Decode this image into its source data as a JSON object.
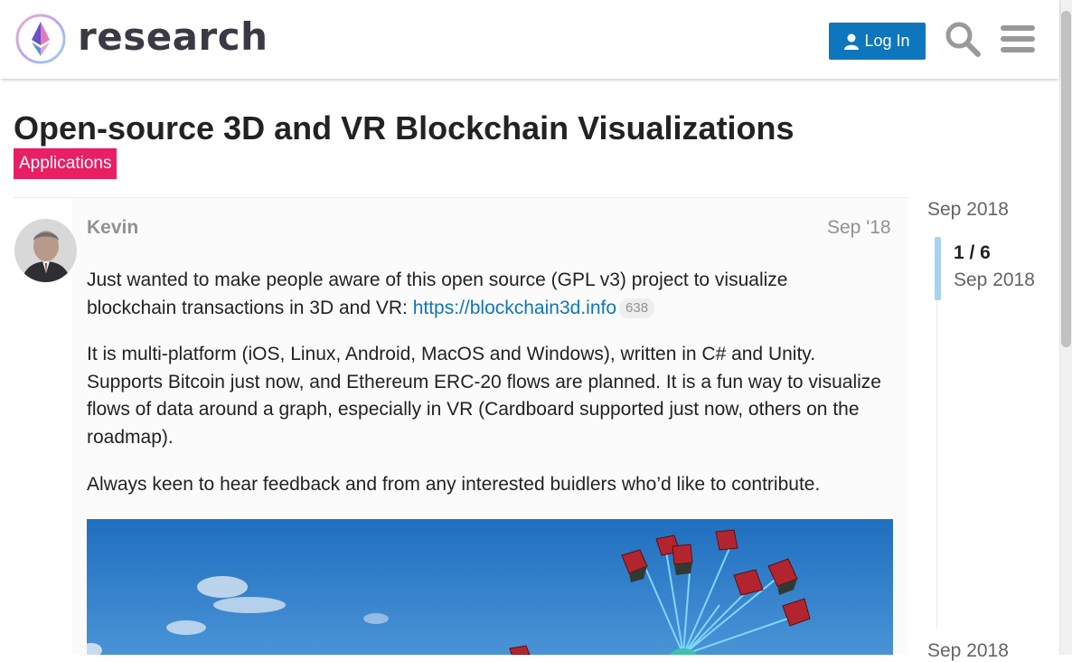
{
  "header": {
    "logo_text": "research",
    "login_label": "Log In"
  },
  "topic": {
    "title": "Open-source 3D and VR Blockchain Visualizations",
    "category": "Applications",
    "category_color": "#e91e63"
  },
  "post": {
    "author": "Kevin",
    "date": "Sep '18",
    "p1_text": "Just wanted to make people aware of this open source (GPL v3) project to visualize blockchain transactions in 3D and VR: ",
    "link_text": "https://blockchain3d.info",
    "link_clicks": "638",
    "p2_text": "It is multi-platform (iOS, Linux, Android, MacOS and Windows), written in C# and Unity. Supports Bitcoin just now, and Ethereum ERC-20 flows are planned. It is a fun way to visualize flows of data around a graph, especially in VR (Cardboard supported just now, others on the roadmap).",
    "p3_text": "Always keen to hear feedback and from any interested buidlers who’d like to contribute."
  },
  "timeline": {
    "top_date": "Sep 2018",
    "position": "1 / 6",
    "current_date": "Sep 2018",
    "bottom_date": "Sep 2018"
  },
  "colors": {
    "accent": "#0e76bd",
    "muted": "#919191"
  }
}
